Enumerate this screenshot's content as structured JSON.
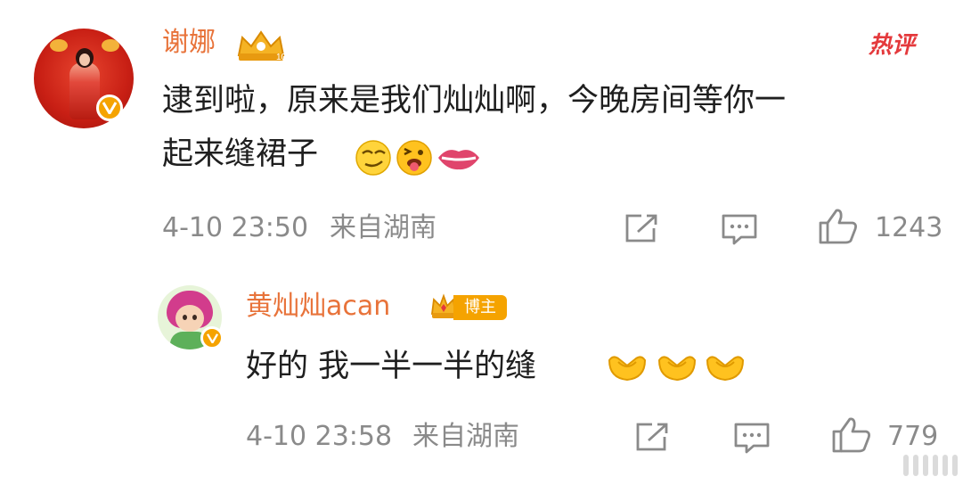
{
  "comment": {
    "username": "谢娜",
    "hot_label": "热评",
    "text_line1": "逮到啦，原来是我们灿灿啊，今晚房间等你一",
    "text_line2": "起来缝裙子",
    "timestamp": "4-10 23:50",
    "location": "来自湖南",
    "like_count": "1243"
  },
  "reply": {
    "username": "黄灿灿acan",
    "badge_label": "博主",
    "text": "好的 我一半一半的缝",
    "timestamp": "4-10 23:58",
    "location": "来自湖南",
    "like_count": "779"
  },
  "colors": {
    "username": "#e8733a",
    "hot": "#e4393c",
    "meta": "#8a8a8a",
    "badge": "#f5a300"
  },
  "icons": [
    "crown-icon",
    "verified-badge-icon",
    "share-icon",
    "comment-icon",
    "thumbs-up-icon",
    "heart-hands-emoji-icon",
    "lips-emoji-icon"
  ]
}
